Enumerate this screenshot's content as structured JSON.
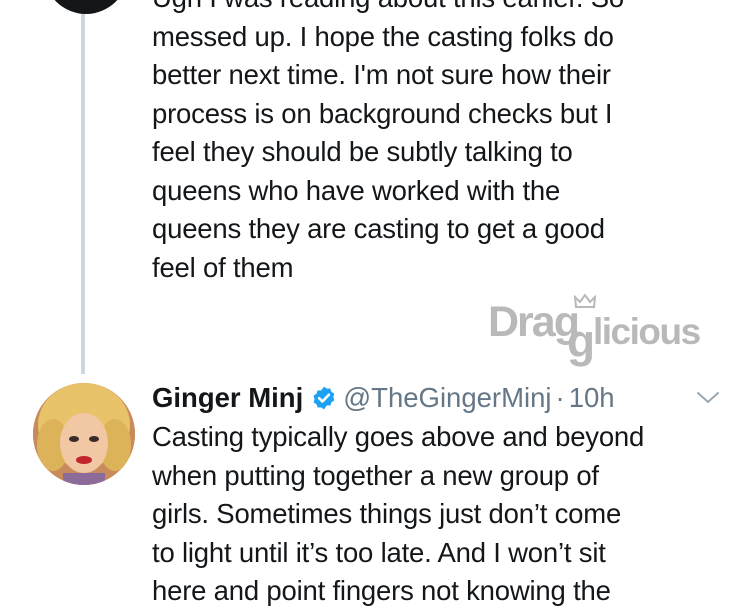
{
  "thread": {
    "previous_tweet_text": "Ugh I was reading about this earlier. So\nmessed up. I hope the casting folks do\nbetter next time. I'm not sure how their\nprocess is on background checks but I\nfeel they should be subtly talking to\nqueens who have worked with the\nqueens they are casting to get a good\nfeel of them"
  },
  "watermark": {
    "part1": "Drag",
    "part2": "g",
    "part3": "licious"
  },
  "reply": {
    "display_name": "Ginger Minj",
    "handle": "@TheGingerMinj",
    "separator": "·",
    "time": "10h",
    "text": "Casting typically goes above and beyond\nwhen putting together a new group of\ngirls. Sometimes things just don’t come\nto light until it’s too late. And I won’t sit\nhere and point fingers not knowing the"
  },
  "icons": {
    "verified": "verified-badge-icon",
    "chevron": "chevron-down-icon"
  },
  "colors": {
    "text": "#14171a",
    "secondary": "#657786",
    "verified": "#1da1f2",
    "thread_line": "#ccd6dd",
    "watermark": "#b9b9b9"
  }
}
